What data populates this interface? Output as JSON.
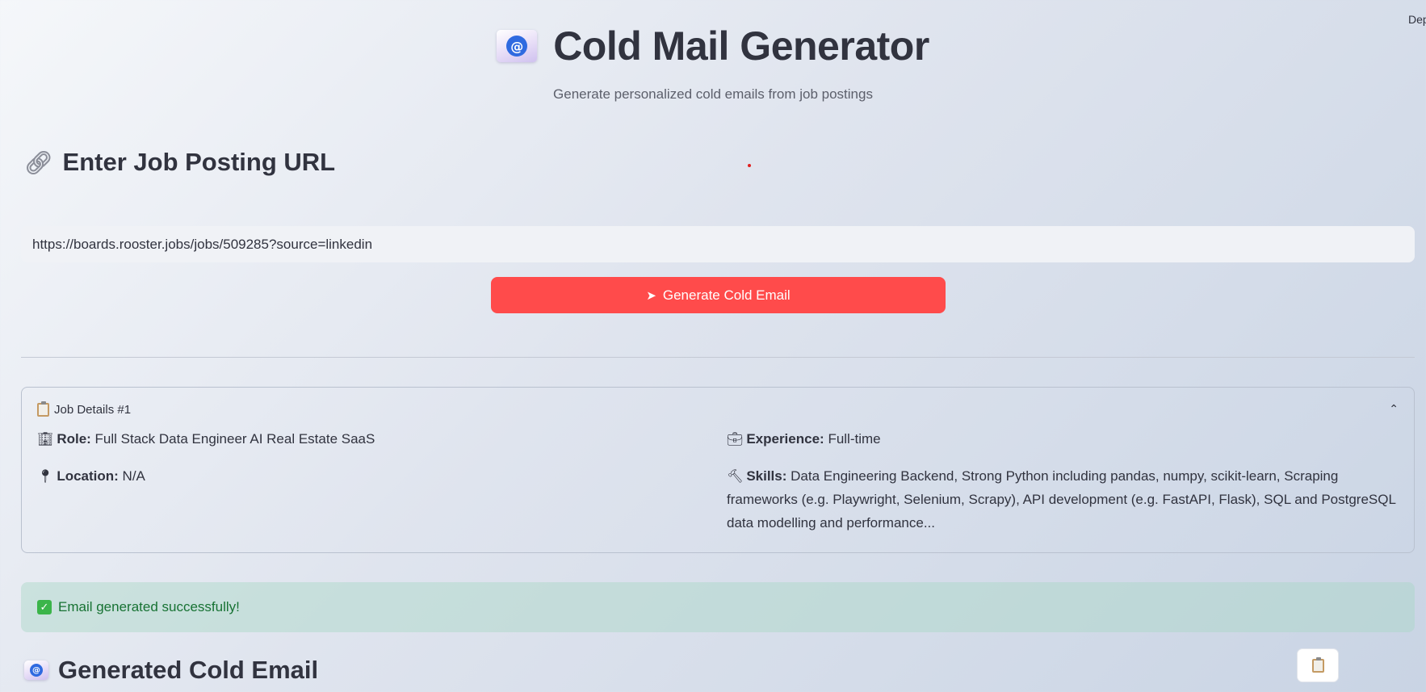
{
  "top_right": {
    "deploy_label": "Deploy"
  },
  "header": {
    "icon": "envelope-at-icon",
    "title": "Cold Mail Generator",
    "subtitle": "Generate personalized cold emails from job postings"
  },
  "url_section": {
    "icon": "link-icon",
    "heading": "Enter Job Posting URL",
    "url_value": "https://boards.rooster.jobs/jobs/509285?source=linkedin",
    "generate_button_icon": "rocket-icon",
    "generate_button_label": "Generate Cold Email"
  },
  "job_details": {
    "icon": "clipboard-icon",
    "title": "Job Details #1",
    "expanded": true,
    "role_label": "Role:",
    "role_value": "Full Stack Data Engineer AI Real Estate SaaS",
    "experience_label": "Experience:",
    "experience_value": "Full-time",
    "location_label": "Location:",
    "location_value": "N/A",
    "skills_label": "Skills:",
    "skills_value": "Data Engineering Backend, Strong Python including pandas, numpy, scikit-learn, Scraping frameworks (e.g. Playwright, Selenium, Scrapy), API development (e.g. FastAPI, Flask), SQL and PostgreSQL data modelling and performance..."
  },
  "status": {
    "icon": "check-icon",
    "message": "Email generated successfully!",
    "color": "#177233"
  },
  "email_section": {
    "icon": "envelope-at-icon",
    "heading": "Generated Cold Email",
    "copy_button_icon": "clipboard-icon"
  },
  "colors": {
    "primary_button": "#ff4b4b",
    "text": "#31333f",
    "success_bg": "#c5e3da"
  }
}
